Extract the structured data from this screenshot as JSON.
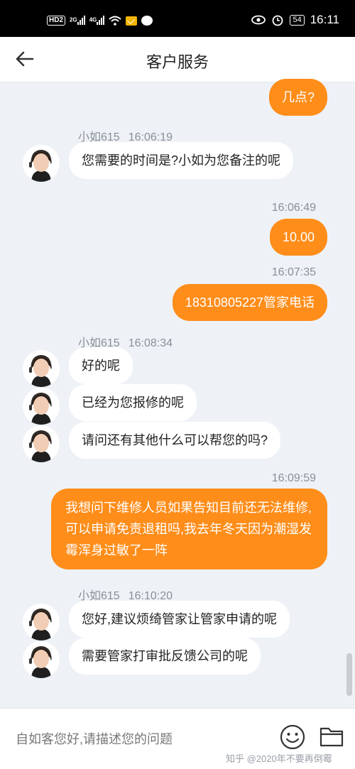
{
  "status_bar": {
    "hd_label": "HD",
    "hd_sub": "2",
    "net1": "2G",
    "net2": "4G",
    "battery": "54",
    "time": "16:11"
  },
  "header": {
    "title": "客户服务"
  },
  "chat": {
    "messages": [
      {
        "text": "几点?"
      },
      {
        "agent": "小如615",
        "time": "16:06:19",
        "text": "您需要的时间是?小如为您备注的呢"
      },
      {
        "time": "16:06:49",
        "text": "10.00"
      },
      {
        "time": "16:07:35",
        "text": "18310805227管家电话"
      },
      {
        "agent": "小如615",
        "time": "16:08:34",
        "texts": [
          "好的呢",
          "已经为您报修的呢",
          "请问还有其他什么可以帮您的吗?"
        ]
      },
      {
        "time": "16:09:59",
        "text": "我想问下维修人员如果告知目前还无法维修,可以申请免责退租吗,我去年冬天因为潮湿发霉浑身过敏了一阵"
      },
      {
        "agent": "小如615",
        "time": "16:10:20",
        "texts": [
          "您好,建议烦绮管家让管家申请的呢",
          "需要管家打审批反馈公司的呢"
        ]
      }
    ]
  },
  "input": {
    "placeholder": "自如客您好,请描述您的问题"
  },
  "watermark": "知乎 @2020年不要再倒霉",
  "colors": {
    "accent": "#ff8d1a",
    "background": "#eef2f7"
  }
}
